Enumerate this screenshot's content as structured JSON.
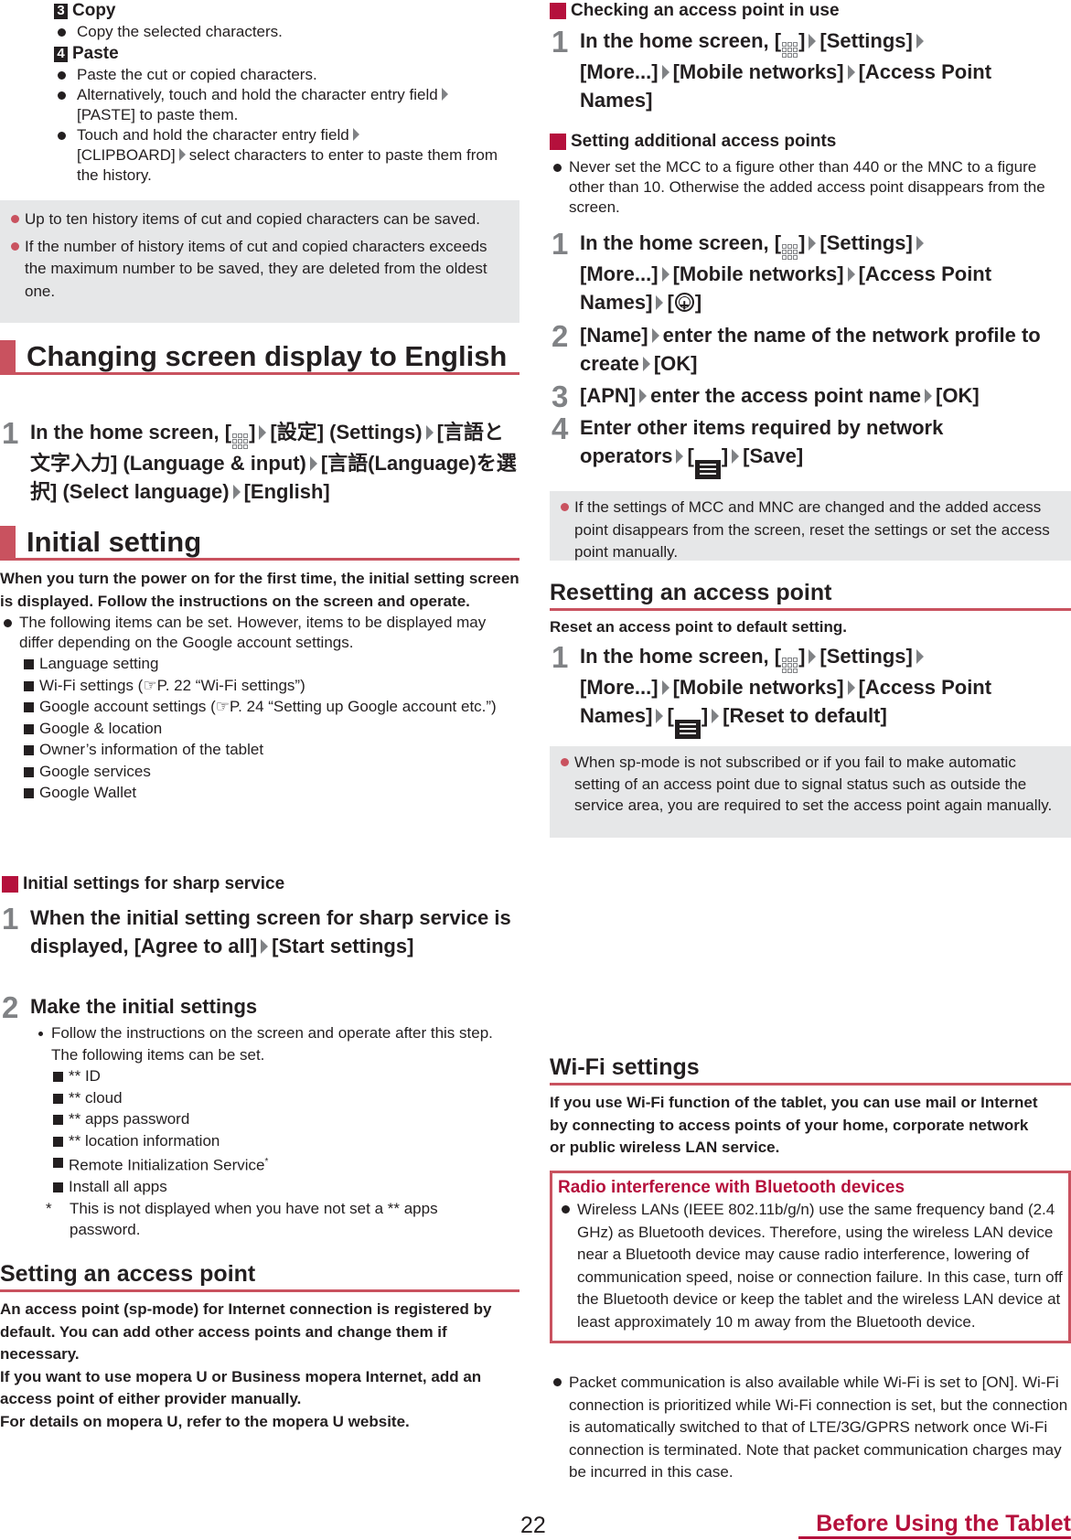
{
  "left": {
    "copy": {
      "num": "3",
      "title": "Copy",
      "bullets": [
        "Copy the selected characters."
      ]
    },
    "paste": {
      "num": "4",
      "title": "Paste",
      "bullets": [
        "Paste the cut or copied characters.",
        {
          "a": "Alternatively, touch and hold the character entry field",
          "b": "[PASTE] to paste them."
        },
        {
          "a": "Touch and hold the character entry field",
          "b": "[CLIPBOARD]",
          "c": "select characters to enter to paste them from the history."
        }
      ]
    },
    "notes1": [
      "Up to ten history items of cut and copied characters can be saved.",
      "If the number of history items of cut and copied characters exceeds the maximum number to be saved, they are deleted from the oldest one."
    ],
    "english": {
      "title": "Changing screen display to English",
      "step": {
        "num": "1",
        "t1": "In the home screen, [",
        "t2": "]",
        "t3": "[設定] (Settings)",
        "t4": "[言語と文字入力] (Language & input)",
        "t5": "[言語(Language)を選択] (Select language)",
        "t6": "[English]"
      }
    },
    "initial": {
      "title": "Initial setting",
      "intro": "When you turn the power on for the first time, the initial setting screen is displayed. Follow the instructions on the screen and operate.",
      "bullet": "The following items can be set. However, items to be displayed may differ depending on the Google account settings.",
      "items": [
        "Language setting",
        "Wi-Fi settings (☞P. 22 “Wi-Fi settings”)",
        "Google account settings (☞P. 24 “Setting up Google account etc.”)",
        "Google & location",
        "Owner’s information of the tablet",
        "Google services",
        "Google Wallet"
      ]
    },
    "sharp": {
      "title": "Initial settings for sharp service",
      "step1": {
        "num": "1",
        "a": "When the initial setting screen for sharp service is displayed, [Agree to all]",
        "b": "[Start settings]"
      },
      "step2": {
        "num": "2",
        "title": "Make the initial settings"
      },
      "dot": "Follow the instructions on the screen and operate after this step. The following items can be set.",
      "items": [
        "** ID",
        "** cloud",
        "** apps password",
        "** location information",
        "Remote Initialization Service",
        "Install all apps"
      ],
      "sup": "*",
      "footnote_mark": "*",
      "footnote": "This is not displayed when you have not set a ** apps password."
    },
    "access": {
      "title": "Setting an access point",
      "p1": "An access point (sp-mode) for Internet connection is registered by default. You can add other access points and change them if necessary.",
      "p2": "If you want to use mopera U or Business mopera Internet, add an access point of either provider manually.",
      "p3": "For details on mopera U, refer to the mopera U website."
    }
  },
  "right": {
    "checking": {
      "title": "Checking an access point in use",
      "step": {
        "num": "1",
        "a": "In the home screen, [",
        "b": "]",
        "c": "[Settings]",
        "d": "[More...]",
        "e": "[Mobile networks]",
        "f": "[Access Point Names]"
      }
    },
    "additional": {
      "title": "Setting additional access points",
      "bullet": "Never set the MCC to a figure other than 440 or the MNC to a figure other than 10. Otherwise the added access point disappears from the screen.",
      "step1": {
        "num": "1",
        "a": "In the home screen, [",
        "b": "]",
        "c": "[Settings]",
        "d": "[More...]",
        "e": "[Mobile networks]",
        "f": "[Access Point Names]",
        "g": "[",
        "h": "]"
      },
      "step2": {
        "num": "2",
        "a": "[Name]",
        "b": "enter the name of the network profile to create",
        "c": "[OK]"
      },
      "step3": {
        "num": "3",
        "a": "[APN]",
        "b": "enter the access point name",
        "c": "[OK]"
      },
      "step4": {
        "num": "4",
        "a": "Enter other items required by network operators",
        "b": "[",
        "c": "]",
        "d": "[Save]"
      },
      "note": "If the settings of MCC and MNC are changed and the added access point disappears from the screen, reset the settings or set the access point manually."
    },
    "resetting": {
      "title": "Resetting an access point",
      "intro": "Reset an access point to default setting.",
      "step": {
        "num": "1",
        "a": "In the home screen, [",
        "b": "]",
        "c": "[Settings]",
        "d": "[More...]",
        "e": "[Mobile networks]",
        "f": "[Access Point Names]",
        "g": "[",
        "h": "]",
        "i": "[Reset to default]"
      },
      "note": "When sp-mode is not subscribed or if you fail to make automatic setting of an access point due to signal status such as outside the service area, you are required to set the access point again manually."
    },
    "wifi": {
      "title": "Wi-Fi settings",
      "intro": "If you use Wi-Fi function of the tablet, you can use mail or Internet by connecting to access points of your home, corporate network or public wireless LAN service.",
      "box_title": "Radio interference with Bluetooth devices",
      "box_bullet": "Wireless LANs (IEEE 802.11b/g/n) use the same frequency band (2.4 GHz) as Bluetooth devices. Therefore, using the wireless LAN device near a Bluetooth device may cause radio interference, lowering of communication speed, noise or connection failure. In this case, turn off the Bluetooth device or keep the tablet and the wireless LAN device at least approximately 10 m away from the Bluetooth device.",
      "bullet": "Packet communication is also available while Wi-Fi is set to [ON]. Wi-Fi connection is prioritized while Wi-Fi connection is set, but the connection is automatically switched to that of LTE/3G/GPRS network once Wi-Fi connection is terminated. Note that packet communication charges may be incurred in this case."
    }
  },
  "footer": {
    "page_number": "22",
    "chapter": "Before Using the Tablet"
  },
  "colors": {
    "accent_red": "#c9525f",
    "brand_crimson": "#b5103c",
    "note_gray": "#e6e7e8",
    "step_gray": "#808285"
  }
}
